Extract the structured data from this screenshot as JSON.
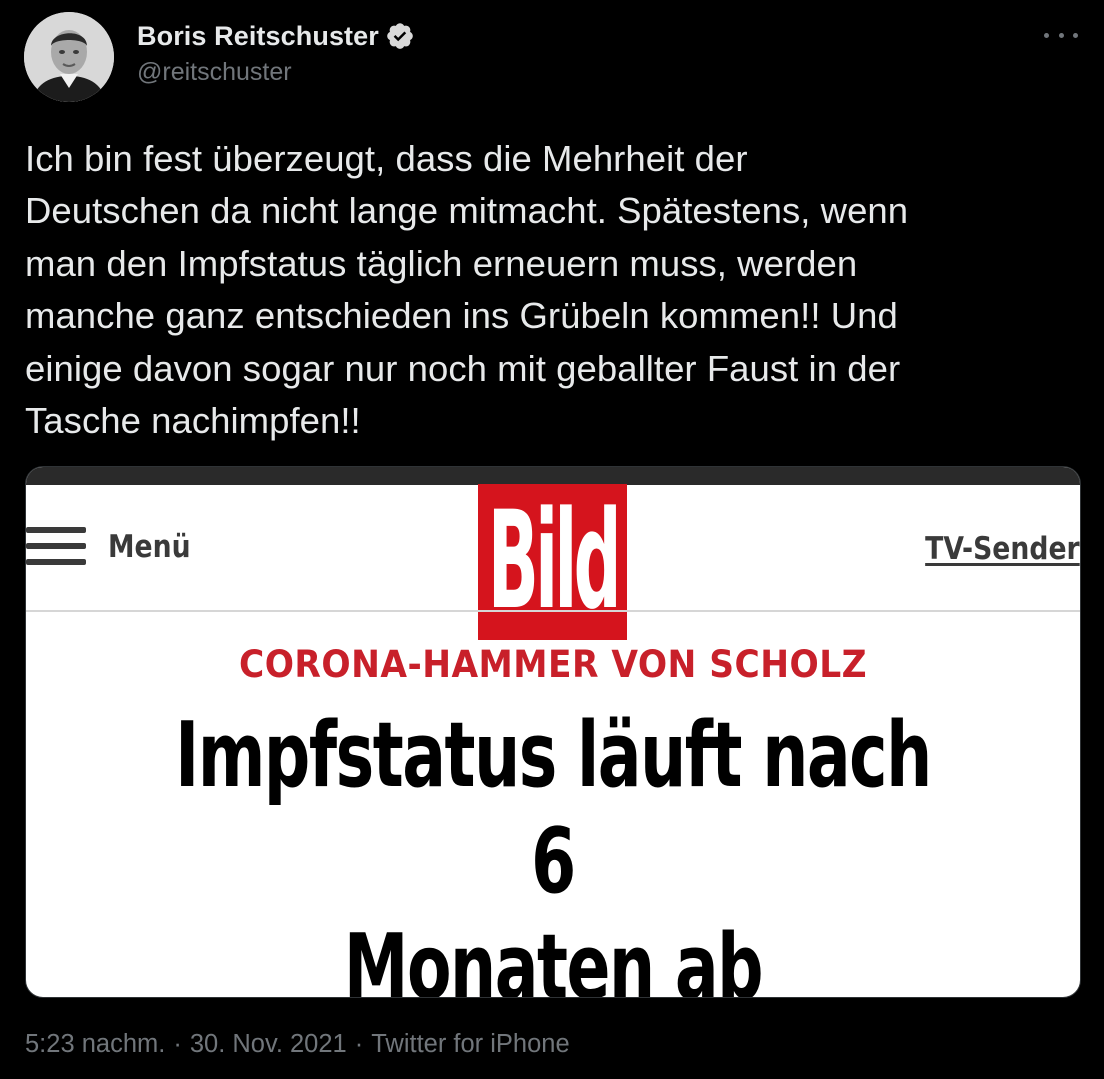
{
  "author": {
    "display_name": "Boris Reitschuster",
    "handle": "@reitschuster",
    "verified": true,
    "verified_icon": "verified-badge-icon"
  },
  "more_icon": "more-horizontal-icon",
  "tweet": {
    "text": "Ich bin fest überzeugt, dass die Mehrheit der\nDeutschen da nicht lange mitmacht. Spätestens, wenn\nman den Impfstatus täglich erneuern muss, werden\nmanche ganz entschieden ins Grübeln kommen!! Und\neinige davon sogar nur noch mit geballter Faust in der\nTasche nachimpfen!!"
  },
  "media": {
    "menu_label": "Menü",
    "logo_text": "Bild",
    "tv_label": "TV-Sender",
    "kicker": "CORONA-HAMMER VON SCHOLZ",
    "headline": "Impfstatus läuft nach 6\nMonaten ab",
    "logo_color": "#d5141d",
    "kicker_color": "#c8202a"
  },
  "meta": {
    "time": "5:23 nachm.",
    "separator": "·",
    "date": "30. Nov. 2021",
    "source": "Twitter for iPhone"
  },
  "colors": {
    "background": "#000000",
    "text": "#e7e9ea",
    "secondary": "#71767b",
    "verified": "#d9d9d9"
  }
}
